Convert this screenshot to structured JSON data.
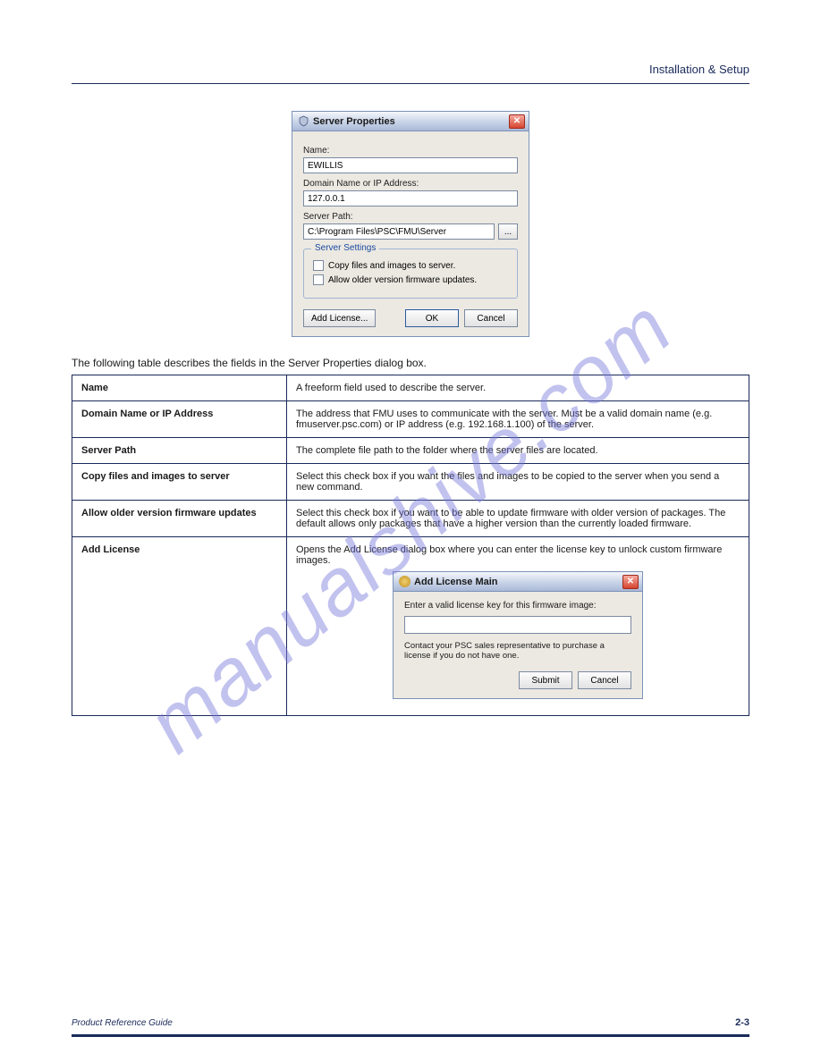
{
  "header": {
    "right": "Installation & Setup"
  },
  "watermark": "manualshive.com",
  "dialog1": {
    "title": "Server Properties",
    "name_label": "Name:",
    "name_value": "EWILLIS",
    "domain_label": "Domain Name or IP Address:",
    "domain_value": "127.0.0.1",
    "path_label": "Server Path:",
    "path_value": "C:\\Program Files\\PSC\\FMU\\Server",
    "browse": "...",
    "settings_legend": "Server Settings",
    "chk1": "Copy files and images to server.",
    "chk2": "Allow older version firmware updates.",
    "btn_add": "Add License...",
    "btn_ok": "OK",
    "btn_cancel": "Cancel"
  },
  "table": {
    "intro": "The following table describes the fields in the Server Properties dialog box.",
    "rows": [
      {
        "label": "Name",
        "desc": "A freeform field used to describe the server."
      },
      {
        "label": "Domain Name or IP Address",
        "desc": "The address that FMU uses to communicate with the server. Must be a valid domain name (e.g. fmuserver.psc.com) or IP address (e.g. 192.168.1.100) of the server."
      },
      {
        "label": "Server Path",
        "desc": "The complete file path to the folder where the server files are located."
      },
      {
        "label": "Copy files and images to server",
        "desc": "Select this check box if you want the files and images to be copied to the server when you send a new command."
      },
      {
        "label": "Allow older version firmware updates",
        "desc": "Select this check box if you want to be able to update firmware with older version of packages. The default allows only packages that have a higher version than the currently loaded firmware."
      },
      {
        "label": "Add License",
        "desc": "Opens the Add License dialog box where you can enter the license key to unlock custom firmware images."
      }
    ]
  },
  "dialog2": {
    "title": "Add License Main",
    "prompt": "Enter a valid license key for this firmware image:",
    "note": "Contact your PSC sales representative to purchase a license if you do not have one.",
    "btn_submit": "Submit",
    "btn_cancel": "Cancel"
  },
  "footer": {
    "copyright": "Product Reference Guide",
    "page": "2-3"
  }
}
